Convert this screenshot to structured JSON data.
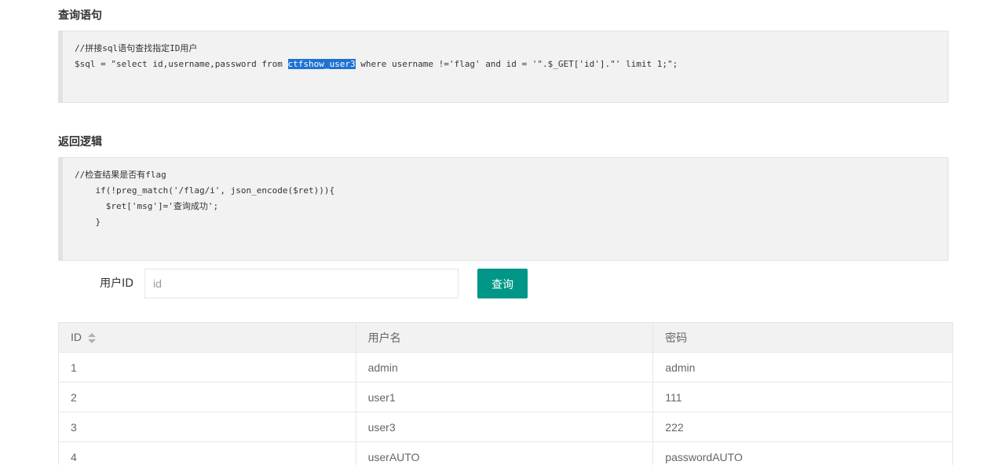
{
  "sections": {
    "query_title": "查询语句",
    "return_title": "返回逻辑"
  },
  "query_code": {
    "line1": "//拼接sql语句查找指定ID用户",
    "line2_before": "$sql = \"select id,username,password from ",
    "line2_highlight": "ctfshow_user3",
    "line2_after": " where username !='flag' and id = '\".$_GET['id'].\"' limit 1;\";"
  },
  "return_code": {
    "line1": "//检查结果是否有flag",
    "line2": "    if(!preg_match('/flag/i', json_encode($ret))){",
    "line3": "      $ret['msg']='查询成功';",
    "line4": "    }"
  },
  "form": {
    "label": "用户ID",
    "placeholder": "id",
    "value": "",
    "submit_label": "查询"
  },
  "table": {
    "headers": [
      "ID",
      "用户名",
      "密码"
    ],
    "rows": [
      [
        "1",
        "admin",
        "admin"
      ],
      [
        "2",
        "user1",
        "111"
      ],
      [
        "3",
        "user3",
        "222"
      ],
      [
        "4",
        "userAUTO",
        "passwordAUTO"
      ]
    ]
  },
  "colors": {
    "accent": "#009688",
    "highlight": "#1e72d2"
  }
}
